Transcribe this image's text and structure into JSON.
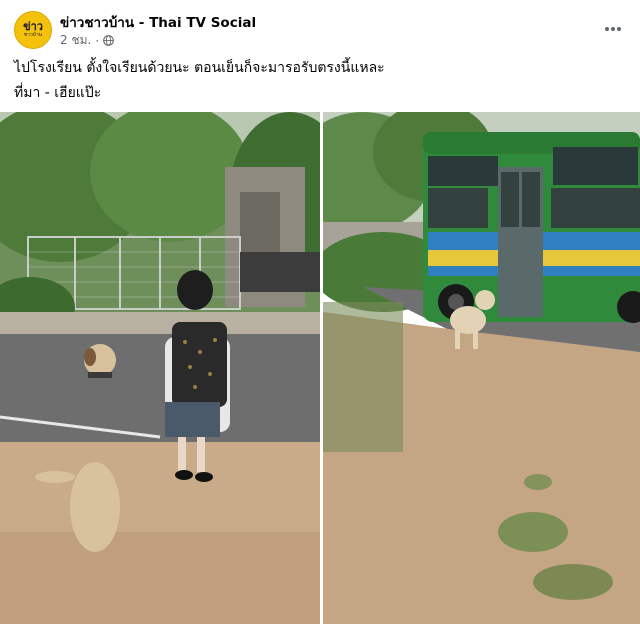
{
  "post": {
    "page_name": "ข่าวชาวบ้าน - Thai TV Social",
    "time": "2 ชม.",
    "separator": "·",
    "text_line1": "ไปโรงเรียน ตั้งใจเรียนด้วยนะ ตอนเย็นก็จะมารอรับตรงนี้แหละ",
    "text_line2": "ที่มา - เฮียแป๊ะ"
  },
  "avatar": {
    "logo_main": "ข่าว",
    "logo_sub": "ชาวบ้าน"
  },
  "icons": {
    "globe": "globe-icon",
    "more": "more-horizontal-icon"
  },
  "colors": {
    "avatar_bg": "#f4c20d",
    "meta_text": "#65676b",
    "bus_green": "#2f8a3c",
    "bus_yellow": "#e6c63a",
    "bus_blue": "#2f7fc1"
  }
}
